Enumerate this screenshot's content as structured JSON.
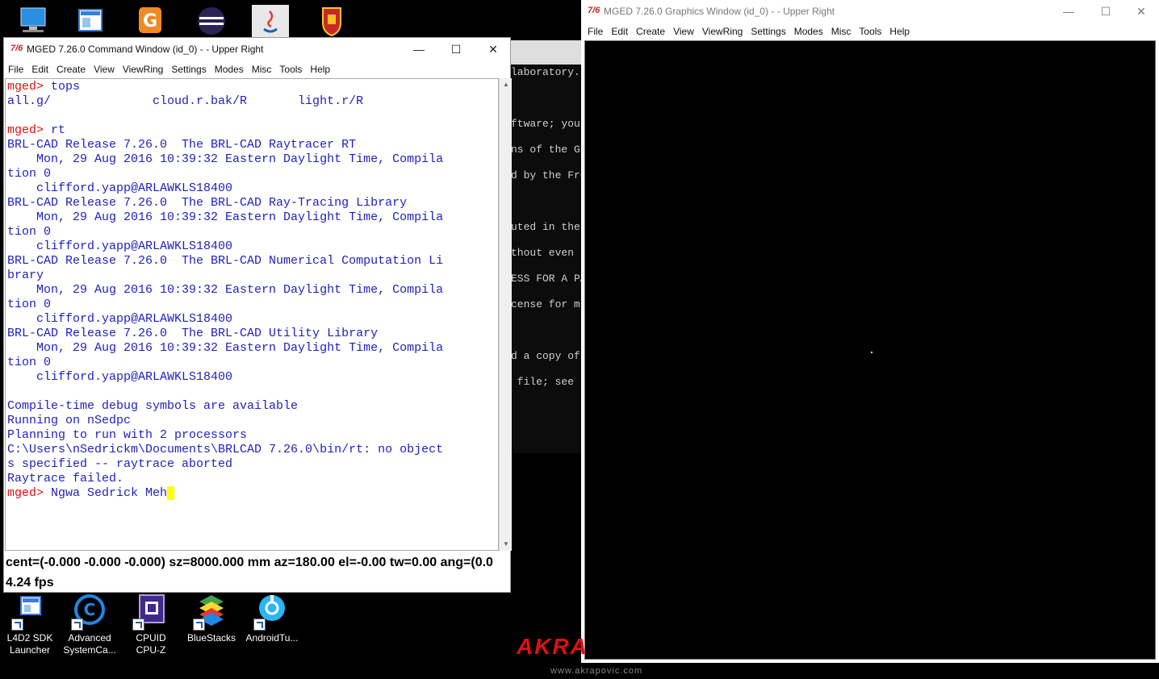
{
  "desktop_top_icons": [
    "computer-icon",
    "window-app-icon",
    "orange-app-icon",
    "eclipse-icon",
    "java-icon",
    "crest-icon"
  ],
  "desktop_bottom_icons": [
    {
      "line1": "L4D2 SDK",
      "line2": "Launcher",
      "icon": "l4d2-sdk-icon"
    },
    {
      "line1": "Advanced",
      "line2": "SystemCa...",
      "icon": "advanced-systemcare-icon"
    },
    {
      "line1": "CPUID",
      "line2": "CPU-Z",
      "icon": "cpuz-icon"
    },
    {
      "line1": "BlueStacks",
      "line2": "",
      "icon": "bluestacks-icon"
    },
    {
      "line1": "AndroidTu...",
      "line2": "",
      "icon": "androidtool-icon"
    }
  ],
  "command_window": {
    "app_icon": "7/6",
    "title": "MGED 7.26.0 Command Window (id_0) -  - Upper Right",
    "menu": [
      "File",
      "Edit",
      "Create",
      "View",
      "ViewRing",
      "Settings",
      "Modes",
      "Misc",
      "Tools",
      "Help"
    ],
    "console_lines": [
      {
        "prompt": "mged> ",
        "text": "tops"
      },
      {
        "prompt": "",
        "text": "all.g/              cloud.r.bak/R       light.r/R"
      },
      {
        "prompt": "",
        "text": ""
      },
      {
        "prompt": "mged> ",
        "text": "rt"
      },
      {
        "prompt": "",
        "text": "BRL-CAD Release 7.26.0  The BRL-CAD Raytracer RT"
      },
      {
        "prompt": "",
        "text": "    Mon, 29 Aug 2016 10:39:32 Eastern Daylight Time, Compila"
      },
      {
        "prompt": "",
        "text": "tion 0"
      },
      {
        "prompt": "",
        "text": "    clifford.yapp@ARLAWKLS18400"
      },
      {
        "prompt": "",
        "text": "BRL-CAD Release 7.26.0  The BRL-CAD Ray-Tracing Library"
      },
      {
        "prompt": "",
        "text": "    Mon, 29 Aug 2016 10:39:32 Eastern Daylight Time, Compila"
      },
      {
        "prompt": "",
        "text": "tion 0"
      },
      {
        "prompt": "",
        "text": "    clifford.yapp@ARLAWKLS18400"
      },
      {
        "prompt": "",
        "text": "BRL-CAD Release 7.26.0  The BRL-CAD Numerical Computation Li"
      },
      {
        "prompt": "",
        "text": "brary"
      },
      {
        "prompt": "",
        "text": "    Mon, 29 Aug 2016 10:39:32 Eastern Daylight Time, Compila"
      },
      {
        "prompt": "",
        "text": "tion 0"
      },
      {
        "prompt": "",
        "text": "    clifford.yapp@ARLAWKLS18400"
      },
      {
        "prompt": "",
        "text": "BRL-CAD Release 7.26.0  The BRL-CAD Utility Library"
      },
      {
        "prompt": "",
        "text": "    Mon, 29 Aug 2016 10:39:32 Eastern Daylight Time, Compila"
      },
      {
        "prompt": "",
        "text": "tion 0"
      },
      {
        "prompt": "",
        "text": "    clifford.yapp@ARLAWKLS18400"
      },
      {
        "prompt": "",
        "text": ""
      },
      {
        "prompt": "",
        "text": "Compile-time debug symbols are available"
      },
      {
        "prompt": "",
        "text": "Running on nSedpc"
      },
      {
        "prompt": "",
        "text": "Planning to run with 2 processors"
      },
      {
        "prompt": "",
        "text": "C:\\Users\\nSedrickm\\Documents\\BRLCAD 7.26.0\\bin/rt: no object"
      },
      {
        "prompt": "",
        "text": "s specified -- raytrace aborted"
      },
      {
        "prompt": "",
        "text": "Raytrace failed."
      }
    ],
    "input_prompt": "mged> ",
    "input_value": "Ngwa Sedrick Meh",
    "status_line": "cent=(-0.000 -0.000 -0.000) sz=8000.000  mm  az=180.00  el=-0.00  tw=0.00  ang=(0.0",
    "fps": "4.24 fps"
  },
  "background_terminal_lines": [
    "laboratory.",
    "ftware; you",
    "ns of the GN",
    "d by the Fre",
    "uted in the",
    "thout even",
    "ESS FOR A PA",
    "cense for m",
    "d a copy of",
    " file; see t"
  ],
  "graphics_window": {
    "app_icon": "7/6",
    "title": "MGED 7.26.0 Graphics Window (id_0) -  - Upper Right",
    "menu": [
      "File",
      "Edit",
      "Create",
      "View",
      "ViewRing",
      "Settings",
      "Modes",
      "Misc",
      "Tools",
      "Help"
    ]
  },
  "wallpaper": {
    "brand": "AKRA",
    "url": "www.akrapovic.com"
  },
  "colors": {
    "console_text": "#1f1fbf",
    "prompt": "#d11111",
    "cursor": "#ffff00",
    "canvas": "#000000",
    "dot": "#ffff88"
  }
}
